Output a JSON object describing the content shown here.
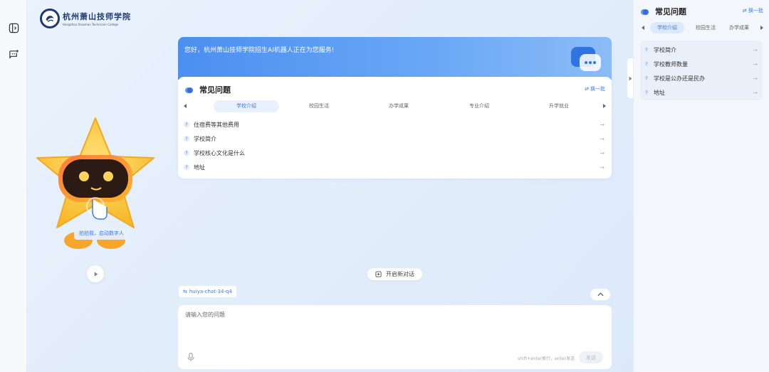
{
  "brand": {
    "logo_cn": "杭州萧山技师学院",
    "logo_en": "Hangzhou Xiaoshan Technician College"
  },
  "mascot": {
    "tip": "拍拍我，启动数字人"
  },
  "welcome": {
    "text": "您好，杭州萧山技师学院招生AI机器人正在为您服务!"
  },
  "faq": {
    "title": "常见问题",
    "refresh_label": "换一批",
    "tabs": [
      {
        "label": "学校介绍",
        "active": true
      },
      {
        "label": "校园生活",
        "active": false
      },
      {
        "label": "办学成果",
        "active": false
      },
      {
        "label": "专业介绍",
        "active": false
      },
      {
        "label": "升学就业",
        "active": false
      }
    ],
    "questions": [
      {
        "text": "住宿费等其他费用"
      },
      {
        "text": "学校简介"
      },
      {
        "text": "学校核心文化是什么"
      },
      {
        "text": "地址"
      }
    ]
  },
  "actions": {
    "new_chat_label": "开启新对话",
    "model_name": "huiya-chat-34-q4"
  },
  "input": {
    "placeholder": "请输入您的问题",
    "hint": "shift+enter换行，enter发送",
    "send_label": "发送"
  },
  "side_panel": {
    "title": "常见问题",
    "refresh_label": "换一批",
    "tabs": [
      {
        "label": "学校介绍",
        "active": true
      },
      {
        "label": "校园生活",
        "active": false
      },
      {
        "label": "办学成果",
        "active": false
      }
    ],
    "questions": [
      {
        "text": "学校简介"
      },
      {
        "text": "学校教师数量"
      },
      {
        "text": "学校是公办还是民办"
      },
      {
        "text": "地址"
      }
    ]
  },
  "colors": {
    "accent": "#3b7de8",
    "welcome_gradient_start": "#4b8ff0",
    "welcome_gradient_end": "#8bbcf7"
  }
}
